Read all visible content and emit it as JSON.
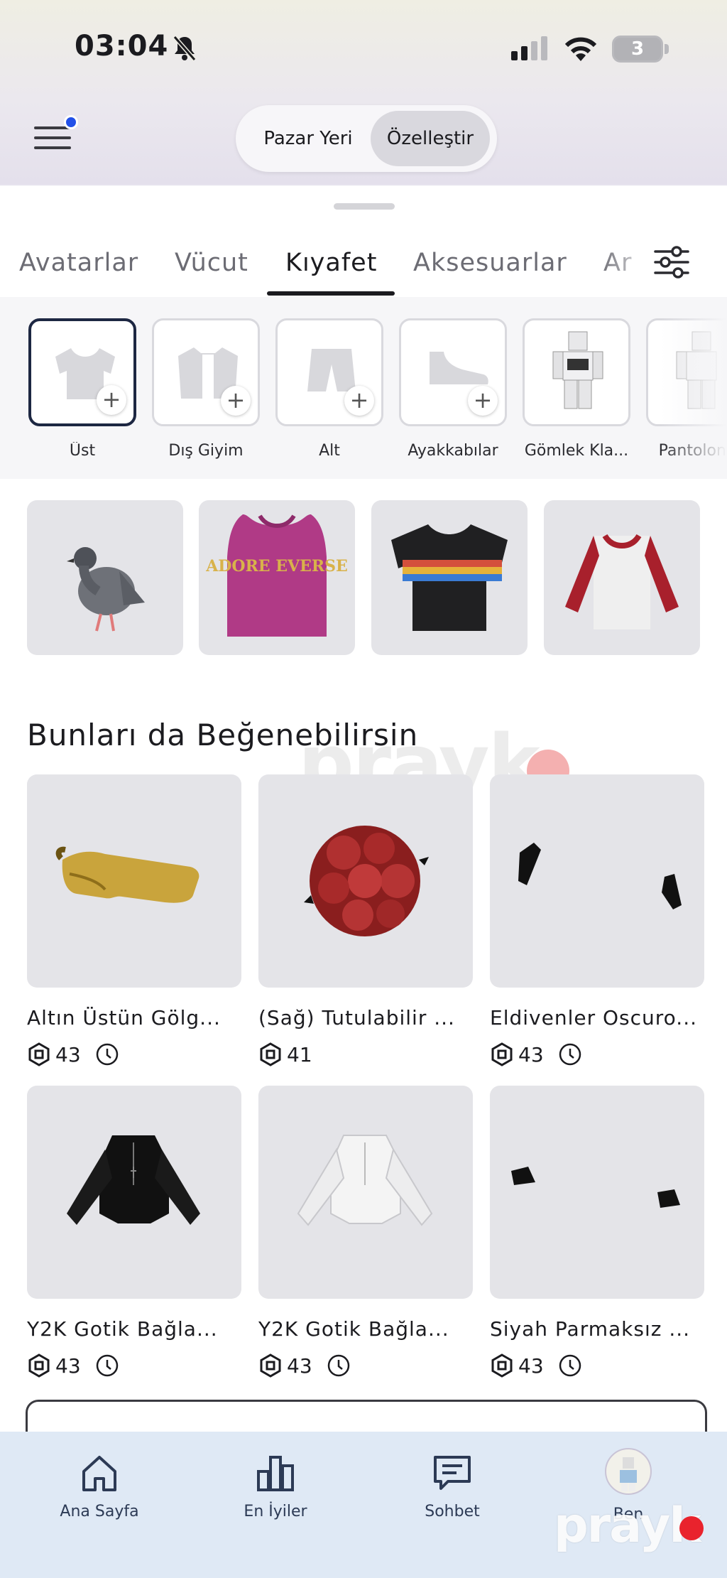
{
  "status_bar": {
    "time": "03:04",
    "battery": "3"
  },
  "top_nav": {
    "segment_marketplace": "Pazar Yeri",
    "segment_customize": "Özelleştir"
  },
  "tabs": [
    {
      "label": "Avatarlar"
    },
    {
      "label": "Vücut"
    },
    {
      "label": "Kıyafet",
      "active": true
    },
    {
      "label": "Aksesuarlar"
    },
    {
      "label": "Ar"
    }
  ],
  "categories": [
    {
      "label": "Üst",
      "icon": "shirt-icon",
      "selected": true
    },
    {
      "label": "Dış Giyim",
      "icon": "jacket-icon"
    },
    {
      "label": "Alt",
      "icon": "pants-icon"
    },
    {
      "label": "Ayakkabılar",
      "icon": "sneaker-icon"
    },
    {
      "label": "Gömlek Kla...",
      "icon": "classic-shirt-icon"
    },
    {
      "label": "Pantolon K",
      "icon": "classic-pants-icon"
    }
  ],
  "wearing": {
    "item2_text": "ADORE EVERSE"
  },
  "recommendations": {
    "title": "Bunları da Beğenebilirsin",
    "items": [
      {
        "name": "Altın Üstün Gölg...",
        "price": "43",
        "limited": true
      },
      {
        "name": "(Sağ) Tutulabilir ...",
        "price": "41",
        "limited": false
      },
      {
        "name": "Eldivenler Oscuro...",
        "price": "43",
        "limited": true
      },
      {
        "name": "Y2K Gotik Bağla...",
        "price": "43",
        "limited": true
      },
      {
        "name": "Y2K Gotik Bağla...",
        "price": "43",
        "limited": true
      },
      {
        "name": "Siyah Parmaksız ...",
        "price": "43",
        "limited": true
      }
    ]
  },
  "bottom_nav": [
    {
      "label": "Ana Sayfa",
      "icon": "home-icon"
    },
    {
      "label": "En İyiler",
      "icon": "chart-icon"
    },
    {
      "label": "Sohbet",
      "icon": "chat-icon"
    },
    {
      "label": "Ben",
      "icon": "avatar"
    }
  ],
  "watermark": "prayk",
  "colors": {
    "accent_dot": "#2250e8",
    "selected_border": "#1d2742",
    "bottom_nav_bg": "#dfe9f5"
  }
}
